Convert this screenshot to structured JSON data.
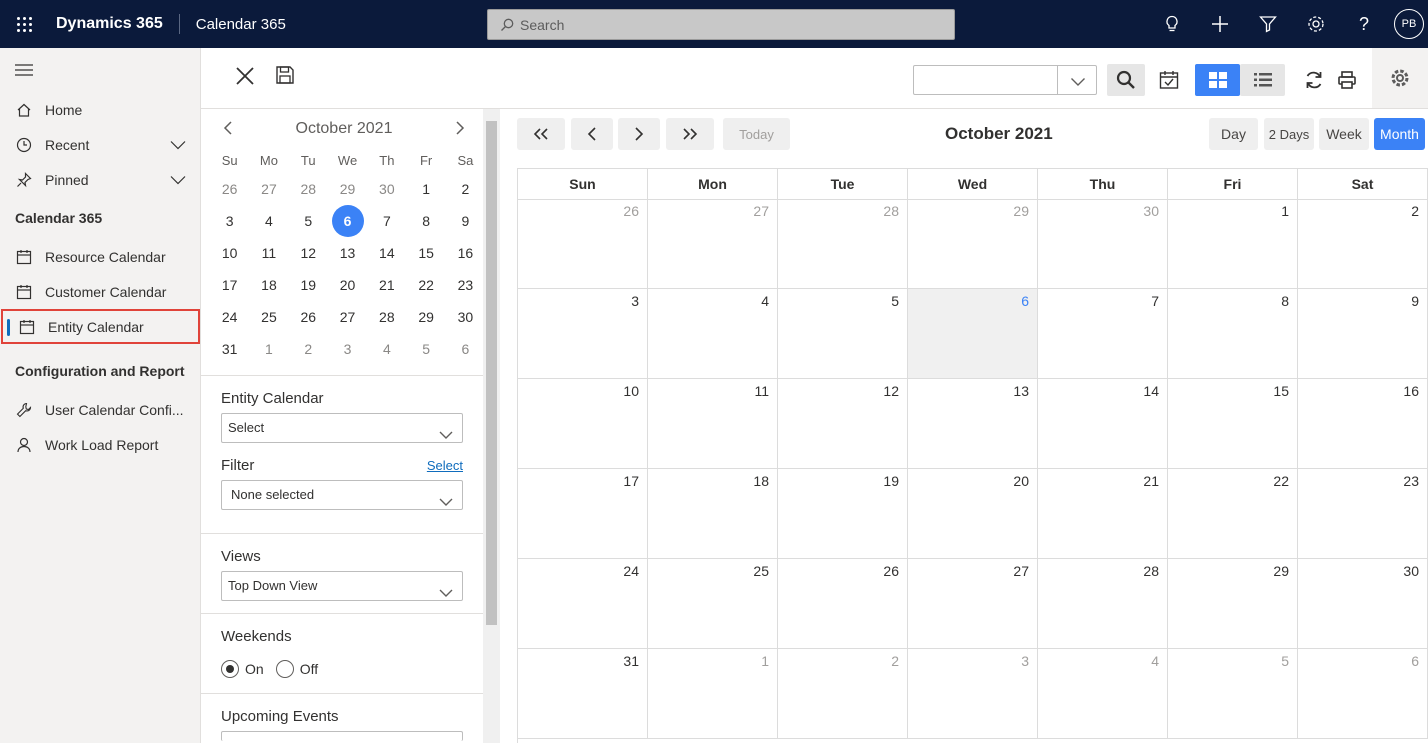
{
  "topbar": {
    "brand": "Dynamics 365",
    "app_name": "Calendar 365",
    "search_placeholder": "Search",
    "avatar_initials": "PB"
  },
  "sidebar": {
    "nav": [
      {
        "label": "Home",
        "icon": "home-icon"
      },
      {
        "label": "Recent",
        "icon": "clock-icon"
      },
      {
        "label": "Pinned",
        "icon": "pin-icon"
      }
    ],
    "section1": "Calendar 365",
    "calendars": [
      {
        "label": "Resource Calendar",
        "icon": "calendar-icon"
      },
      {
        "label": "Customer Calendar",
        "icon": "calendar-icon"
      },
      {
        "label": "Entity Calendar",
        "icon": "calendar-icon",
        "active": true
      }
    ],
    "section2": "Configuration and Report",
    "config": [
      {
        "label": "User Calendar Confi...",
        "icon": "wrench-icon"
      },
      {
        "label": "Work Load Report",
        "icon": "person-icon"
      }
    ]
  },
  "mini_calendar": {
    "title": "October 2021",
    "weekdays": [
      "Su",
      "Mo",
      "Tu",
      "We",
      "Th",
      "Fr",
      "Sa"
    ],
    "days": [
      "26",
      "27",
      "28",
      "29",
      "30",
      "1",
      "2",
      "3",
      "4",
      "5",
      "6",
      "7",
      "8",
      "9",
      "10",
      "11",
      "12",
      "13",
      "14",
      "15",
      "16",
      "17",
      "18",
      "19",
      "20",
      "21",
      "22",
      "23",
      "24",
      "25",
      "26",
      "27",
      "28",
      "29",
      "30",
      "31",
      "1",
      "2",
      "3",
      "4",
      "5",
      "6"
    ],
    "other_month": [
      0,
      1,
      2,
      3,
      4,
      36,
      37,
      38,
      39,
      40,
      41
    ],
    "today_index": 10
  },
  "panel": {
    "entity_label": "Entity Calendar",
    "entity_value": "Select",
    "filter_label": "Filter",
    "filter_link": "Select",
    "filter_value": "None selected",
    "views_label": "Views",
    "views_value": "Top Down View",
    "weekends_label": "Weekends",
    "weekend_on": "On",
    "weekend_off": "Off",
    "weekend_selected": "On",
    "upcoming_label": "Upcoming Events"
  },
  "calendar": {
    "title": "October 2021",
    "today_label": "Today",
    "views": [
      "Day",
      "2 Days",
      "Week",
      "Month"
    ],
    "active_view": "Month",
    "headers": [
      "Sun",
      "Mon",
      "Tue",
      "Wed",
      "Thu",
      "Fri",
      "Sat"
    ],
    "days": [
      "26",
      "27",
      "28",
      "29",
      "30",
      "1",
      "2",
      "3",
      "4",
      "5",
      "6",
      "7",
      "8",
      "9",
      "10",
      "11",
      "12",
      "13",
      "14",
      "15",
      "16",
      "17",
      "18",
      "19",
      "20",
      "21",
      "22",
      "23",
      "24",
      "25",
      "26",
      "27",
      "28",
      "29",
      "30",
      "31",
      "1",
      "2",
      "3",
      "4",
      "5",
      "6"
    ],
    "other_month": [
      0,
      1,
      2,
      3,
      4,
      36,
      37,
      38,
      39,
      40,
      41
    ],
    "today_index": 10
  },
  "colors": {
    "topbar": "#0b1a3b",
    "accent": "#3b82f6",
    "highlight_border": "#e0433a"
  }
}
